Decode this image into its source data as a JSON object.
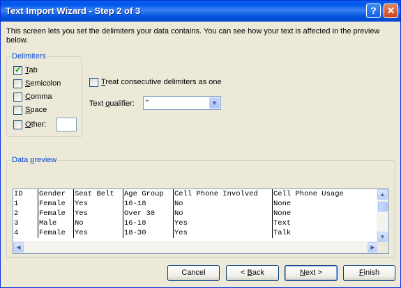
{
  "window": {
    "title": "Text Import Wizard - Step 2 of 3"
  },
  "titlebar": {
    "help_label": "?",
    "close_label": "✕"
  },
  "intro": "This screen lets you set the delimiters your data contains.  You can see how your text is affected in the preview below.",
  "delimiters": {
    "title": "Delimiters",
    "options": [
      {
        "mnemonic": "T",
        "rest": "ab",
        "checked": true
      },
      {
        "mnemonic": "S",
        "rest": "emicolon",
        "checked": false
      },
      {
        "mnemonic": "C",
        "rest": "omma",
        "checked": false
      },
      {
        "mnemonic": "S",
        "rest": "pace",
        "checked": false
      },
      {
        "mnemonic": "O",
        "rest": "ther:",
        "checked": false
      }
    ],
    "other_value": ""
  },
  "consecutive": {
    "pre": "",
    "mnemonic": "T",
    "rest": "reat consecutive delimiters as one",
    "checked": false
  },
  "qualifier": {
    "pre": "Text ",
    "mnemonic": "q",
    "rest": "ualifier:",
    "value": "\""
  },
  "preview": {
    "title": "Data ",
    "mnemonic": "p",
    "rest": "review",
    "rows": [
      [
        "ID",
        "Gender",
        "Seat Belt",
        "Age Group",
        "Cell Phone Involved",
        "Cell Phone Usage"
      ],
      [
        "1",
        "Female",
        "Yes",
        "16-18",
        "No",
        "None"
      ],
      [
        "2",
        "Female",
        "Yes",
        "Over 30",
        "No",
        "None"
      ],
      [
        "3",
        "Male",
        "No",
        "16-18",
        "Yes",
        "Text"
      ],
      [
        "4",
        "Female",
        "Yes",
        "18-30",
        "Yes",
        "Talk"
      ]
    ]
  },
  "buttons": {
    "cancel": "Cancel",
    "back_pre": "< ",
    "back_mn": "B",
    "back_rest": "ack",
    "next_pre": "",
    "next_mn": "N",
    "next_rest": "ext >",
    "finish_mn": "F",
    "finish_rest": "inish"
  },
  "icons": {
    "check": "✓",
    "dropdown": "▼",
    "up": "▲",
    "down": "▼",
    "left": "◀",
    "right": "▶"
  }
}
